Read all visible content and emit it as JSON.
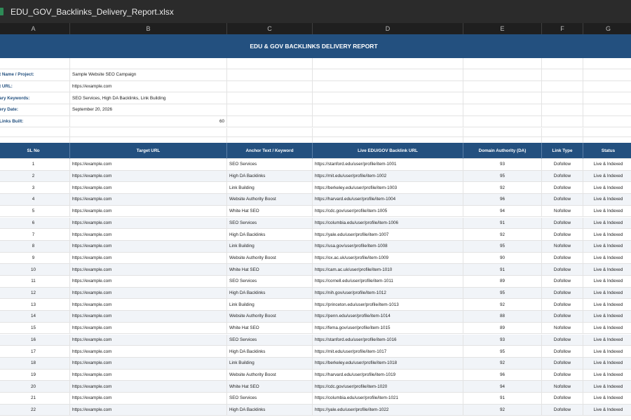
{
  "window": {
    "title": "EDU_GOV_Backlinks_Delivery_Report.xlsx"
  },
  "columns": [
    "A",
    "B",
    "C",
    "D",
    "E",
    "F",
    "G"
  ],
  "report": {
    "title": "EDU & GOV BACKLINKS DELIVERY REPORT",
    "info": [
      {
        "label": "t Name / Project:",
        "value": "Sample Website SEO Campaign"
      },
      {
        "label": "t URL:",
        "value": "https://example.com"
      },
      {
        "label": "ary Keywords:",
        "value": "SEO Services, High DA Backlinks, Link Building"
      },
      {
        "label": "ery Date:",
        "value": "September 20, 2026"
      },
      {
        "label": "Links Built:",
        "value": "60"
      }
    ]
  },
  "table": {
    "headers": [
      "SL No",
      "Target URL",
      "Anchor Text / Keyword",
      "Live EDU/GOV Backlink URL",
      "Domain Authority (DA)",
      "Link Type",
      "Status"
    ],
    "rows": [
      [
        "1",
        "https://example.com",
        "SEO Services",
        "https://stanford.edu/user/profile/item-1001",
        "93",
        "Dofollow",
        "Live & Indexed"
      ],
      [
        "2",
        "https://example.com",
        "High DA Backlinks",
        "https://mit.edu/user/profile/item-1002",
        "95",
        "Dofollow",
        "Live & Indexed"
      ],
      [
        "3",
        "https://example.com",
        "Link Building",
        "https://berkeley.edu/user/profile/item-1003",
        "92",
        "Dofollow",
        "Live & Indexed"
      ],
      [
        "4",
        "https://example.com",
        "Website Authority Boost",
        "https://harvard.edu/user/profile/item-1004",
        "96",
        "Dofollow",
        "Live & Indexed"
      ],
      [
        "5",
        "https://example.com",
        "White Hat SEO",
        "https://cdc.gov/user/profile/item-1005",
        "94",
        "Nofollow",
        "Live & Indexed"
      ],
      [
        "6",
        "https://example.com",
        "SEO Services",
        "https://columbia.edu/user/profile/item-1006",
        "91",
        "Dofollow",
        "Live & Indexed"
      ],
      [
        "7",
        "https://example.com",
        "High DA Backlinks",
        "https://yale.edu/user/profile/item-1007",
        "92",
        "Dofollow",
        "Live & Indexed"
      ],
      [
        "8",
        "https://example.com",
        "Link Building",
        "https://usa.gov/user/profile/item-1008",
        "95",
        "Nofollow",
        "Live & Indexed"
      ],
      [
        "9",
        "https://example.com",
        "Website Authority Boost",
        "https://ox.ac.uk/user/profile/item-1009",
        "90",
        "Dofollow",
        "Live & Indexed"
      ],
      [
        "10",
        "https://example.com",
        "White Hat SEO",
        "https://cam.ac.uk/user/profile/item-1010",
        "91",
        "Dofollow",
        "Live & Indexed"
      ],
      [
        "11",
        "https://example.com",
        "SEO Services",
        "https://cornell.edu/user/profile/item-1011",
        "89",
        "Dofollow",
        "Live & Indexed"
      ],
      [
        "12",
        "https://example.com",
        "High DA Backlinks",
        "https://nih.gov/user/profile/item-1012",
        "95",
        "Dofollow",
        "Live & Indexed"
      ],
      [
        "13",
        "https://example.com",
        "Link Building",
        "https://princeton.edu/user/profile/item-1013",
        "92",
        "Dofollow",
        "Live & Indexed"
      ],
      [
        "14",
        "https://example.com",
        "Website Authority Boost",
        "https://penn.edu/user/profile/item-1014",
        "88",
        "Dofollow",
        "Live & Indexed"
      ],
      [
        "15",
        "https://example.com",
        "White Hat SEO",
        "https://fema.gov/user/profile/item-1015",
        "89",
        "Nofollow",
        "Live & Indexed"
      ],
      [
        "16",
        "https://example.com",
        "SEO Services",
        "https://stanford.edu/user/profile/item-1016",
        "93",
        "Dofollow",
        "Live & Indexed"
      ],
      [
        "17",
        "https://example.com",
        "High DA Backlinks",
        "https://mit.edu/user/profile/item-1017",
        "95",
        "Dofollow",
        "Live & Indexed"
      ],
      [
        "18",
        "https://example.com",
        "Link Building",
        "https://berkeley.edu/user/profile/item-1018",
        "92",
        "Dofollow",
        "Live & Indexed"
      ],
      [
        "19",
        "https://example.com",
        "Website Authority Boost",
        "https://harvard.edu/user/profile/item-1019",
        "96",
        "Dofollow",
        "Live & Indexed"
      ],
      [
        "20",
        "https://example.com",
        "White Hat SEO",
        "https://cdc.gov/user/profile/item-1020",
        "94",
        "Nofollow",
        "Live & Indexed"
      ],
      [
        "21",
        "https://example.com",
        "SEO Services",
        "https://columbia.edu/user/profile/item-1021",
        "91",
        "Dofollow",
        "Live & Indexed"
      ],
      [
        "22",
        "https://example.com",
        "High DA Backlinks",
        "https://yale.edu/user/profile/item-1022",
        "92",
        "Dofollow",
        "Live & Indexed"
      ]
    ]
  },
  "colors": {
    "header_blue": "#23507f",
    "alt_row": "#f1f4f8",
    "titlebar": "#2b2b2b"
  }
}
